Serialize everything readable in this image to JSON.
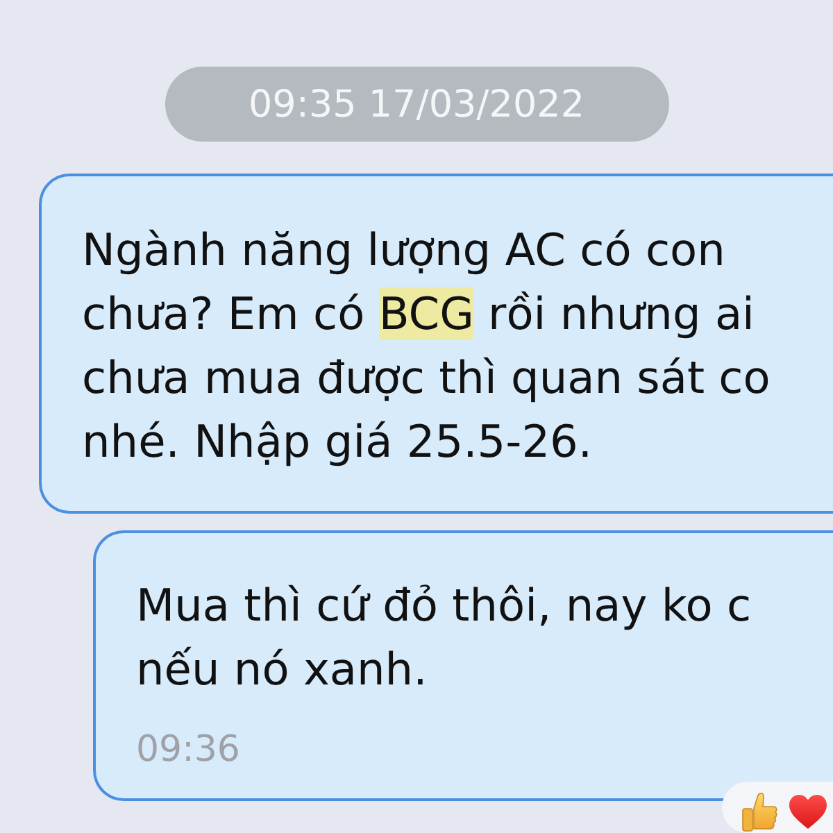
{
  "date_divider": {
    "label": "09:35 17/03/2022"
  },
  "messages": [
    {
      "lines": [
        [
          {
            "text": "Ngành năng lượng AC có con",
            "highlighted": false
          }
        ],
        [
          {
            "text": "chưa? Em có ",
            "highlighted": false
          },
          {
            "text": "BCG",
            "highlighted": true
          },
          {
            "text": " rồi nhưng ai",
            "highlighted": false
          }
        ],
        [
          {
            "text": "chưa mua được thì quan sát co",
            "highlighted": false
          }
        ],
        [
          {
            "text": "nhé. Nhập giá 25.5-26.",
            "highlighted": false
          }
        ]
      ]
    },
    {
      "lines": [
        [
          {
            "text": "Mua thì cứ đỏ thôi, nay ko c",
            "highlighted": false
          }
        ],
        [
          {
            "text": "nếu nó xanh.",
            "highlighted": false
          }
        ]
      ],
      "time": "09:36",
      "reactions": [
        {
          "kind": "thumbs_up"
        },
        {
          "kind": "heart"
        }
      ]
    }
  ]
}
